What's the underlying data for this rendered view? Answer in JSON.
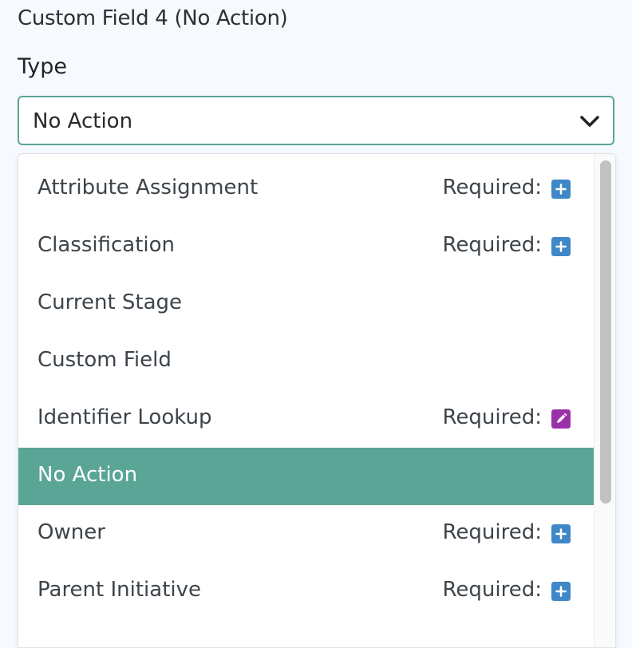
{
  "section_title": "Custom Field 4 (No Action)",
  "type_field": {
    "label": "Type",
    "selected_value": "No Action",
    "chevron_icon": "chevron-down-icon"
  },
  "colors": {
    "accent": "#5ba597",
    "plus_badge": "#3f87c7",
    "edit_badge": "#9b31a8"
  },
  "options": [
    {
      "label": "Attribute Assignment",
      "required_label": "Required:",
      "required_icon": "plus-square-icon"
    },
    {
      "label": "Classification",
      "required_label": "Required:",
      "required_icon": "plus-square-icon"
    },
    {
      "label": "Current Stage"
    },
    {
      "label": "Custom Field"
    },
    {
      "label": "Identifier Lookup",
      "required_label": "Required:",
      "required_icon": "edit-square-icon"
    },
    {
      "label": "No Action",
      "selected": true
    },
    {
      "label": "Owner",
      "required_label": "Required:",
      "required_icon": "plus-square-icon"
    },
    {
      "label": "Parent Initiative",
      "required_label": "Required:",
      "required_icon": "plus-square-icon"
    },
    {
      "label": ""
    }
  ]
}
